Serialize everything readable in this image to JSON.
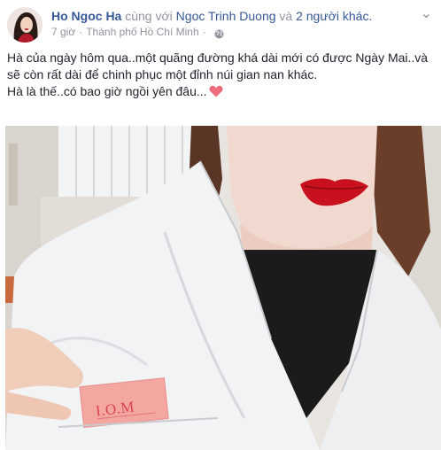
{
  "post": {
    "author": "Ho Ngoc Ha",
    "with_text": "cùng với",
    "tagged_friend": "Ngoc Trinh Duong",
    "and_text": "và",
    "others": "2 người khác.",
    "time": "7 giờ",
    "location": "Thành phố Hồ Chí Minh",
    "privacy_icon": "globe-icon",
    "caption_line1": "Hà của ngày hôm qua..một quãng đường khá dài mới có được Ngày Mai..và",
    "caption_line2": "sẽ còn rất dài để chinh phục một đỉnh núi gian nan khác.",
    "caption_line3": "Hà là thế..có bao giờ ngồi yên đâu...",
    "caption_emoji": "heart-icon"
  },
  "photo": {
    "label_text": "I.O.M"
  },
  "colors": {
    "link": "#365899",
    "muted": "#90949c",
    "heart": "#f06d7e",
    "lips": "#c8101e"
  }
}
